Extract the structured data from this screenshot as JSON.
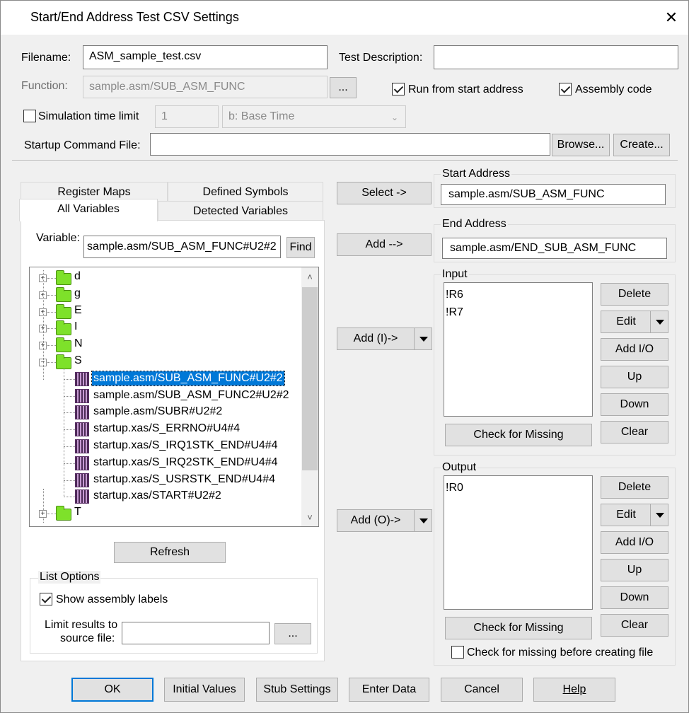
{
  "window": {
    "title": "Start/End Address Test CSV Settings",
    "close_label": "✕"
  },
  "filename": {
    "label": "Filename:",
    "value": "ASM_sample_test.csv"
  },
  "test_description": {
    "label": "Test Description:",
    "value": ""
  },
  "function": {
    "label": "Function:",
    "value": "sample.asm/SUB_ASM_FUNC",
    "browse_label": "..."
  },
  "run_from_start": {
    "label": "Run from start address",
    "checked": true
  },
  "assembly_code": {
    "label": "Assembly code",
    "checked": true
  },
  "sim_time_limit": {
    "label": "Simulation time limit",
    "checked": false,
    "value": "1",
    "unit": "b: Base Time"
  },
  "startup_command_file": {
    "label": "Startup Command File:",
    "value": "",
    "browse_label": "Browse...",
    "create_label": "Create..."
  },
  "tabs": {
    "register_maps": "Register Maps",
    "defined_symbols": "Defined Symbols",
    "all_variables": "All Variables",
    "detected_variables": "Detected Variables"
  },
  "variable": {
    "label": "Variable:",
    "value": "sample.asm/SUB_ASM_FUNC#U2#2",
    "find_label": "Find"
  },
  "tree": {
    "folders_top": [
      "d",
      "g",
      "E",
      "I",
      "N",
      "S"
    ],
    "children": [
      "sample.asm/SUB_ASM_FUNC#U2#2",
      "sample.asm/SUB_ASM_FUNC2#U2#2",
      "sample.asm/SUBR#U2#2",
      "startup.xas/S_ERRNO#U4#4",
      "startup.xas/S_IRQ1STK_END#U4#4",
      "startup.xas/S_IRQ2STK_END#U4#4",
      "startup.xas/S_USRSTK_END#U4#4",
      "startup.xas/START#U2#2"
    ],
    "folder_bottom": "T",
    "expand_plus": "+",
    "expand_minus": "−",
    "scroll_up": "˄",
    "scroll_down": "˅"
  },
  "refresh_label": "Refresh",
  "list_options": {
    "title": "List Options",
    "show_assembly_labels": {
      "label": "Show assembly labels",
      "checked": true
    },
    "limit_label_1": "Limit results to",
    "limit_label_2": "source file:",
    "limit_value": "",
    "browse_label": "..."
  },
  "middle_buttons": {
    "select": "Select ->",
    "add": "Add -->",
    "add_input": "Add (I)->",
    "add_output": "Add (O)->"
  },
  "start_address": {
    "title": "Start Address",
    "value": "sample.asm/SUB_ASM_FUNC"
  },
  "end_address": {
    "title": "End Address",
    "value": "sample.asm/END_SUB_ASM_FUNC"
  },
  "input": {
    "title": "Input",
    "items": [
      "!R6",
      "!R7"
    ],
    "delete": "Delete",
    "edit": "Edit",
    "add_io": "Add I/O",
    "up": "Up",
    "down": "Down",
    "clear": "Clear",
    "check_missing": "Check for Missing"
  },
  "output": {
    "title": "Output",
    "items": [
      "!R0"
    ],
    "delete": "Delete",
    "edit": "Edit",
    "add_io": "Add I/O",
    "up": "Up",
    "down": "Down",
    "clear": "Clear",
    "check_missing": "Check for Missing",
    "check_before_create": {
      "label": "Check for missing before creating file",
      "checked": false
    }
  },
  "bottom_buttons": {
    "ok": "OK",
    "initial_values": "Initial Values",
    "stub_settings": "Stub Settings",
    "enter_data": "Enter Data",
    "cancel": "Cancel",
    "help": "Help"
  }
}
